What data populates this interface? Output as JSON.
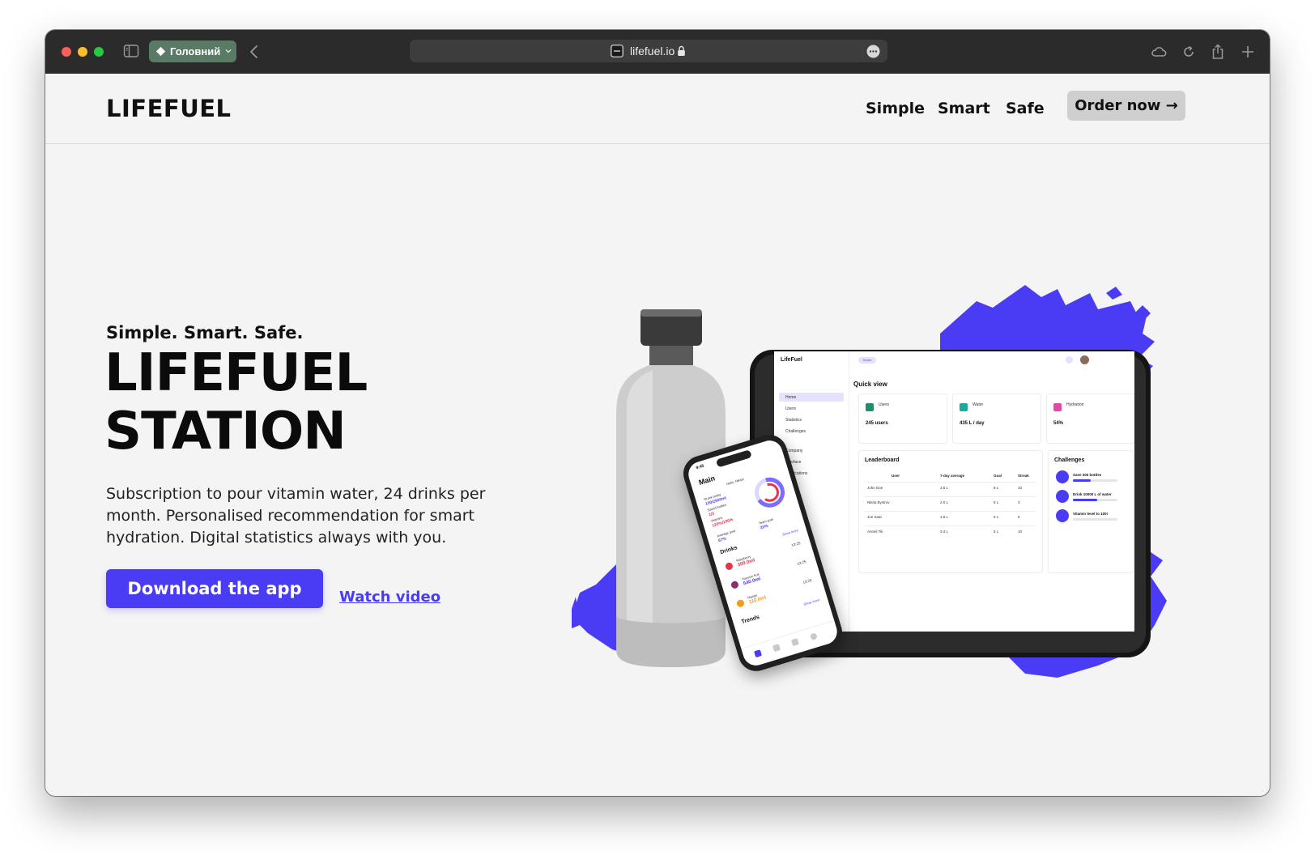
{
  "browser": {
    "tab_group_label": "Головний",
    "url": "lifefuel.io"
  },
  "site": {
    "logo": "LIFEFUEL",
    "nav": [
      "Simple",
      "Smart",
      "Safe"
    ],
    "order_button": "Order now →"
  },
  "hero": {
    "tagline": "Simple. Smart. Safe.",
    "title_line1": "LIFEFUEL",
    "title_line2": "STATION",
    "description": "Subscription to pour vitamin water, 24 drinks per month. Personalised recommendation for smart hydration. Digital statistics always with you.",
    "download_button": "Download the app",
    "watch_link": "Watch video"
  },
  "tablet": {
    "brand": "LifeFuel",
    "breadcrumb": "Home",
    "nav_items": [
      "Home",
      "Users",
      "Statistics",
      "Challenges",
      "Company",
      "Interface",
      "Notifications"
    ],
    "quick_view_title": "Quick view",
    "cards": [
      {
        "label": "Users",
        "value": "245 users",
        "color": "#1f8f6a"
      },
      {
        "label": "Water",
        "value": "435 L / day",
        "color": "#18a9a0"
      },
      {
        "label": "Hydration",
        "value": "54%",
        "color": "#e04aa8"
      }
    ],
    "leaderboard": {
      "title": "Leaderboard",
      "headers": [
        "User",
        "7-day average",
        "Goal",
        "Streak"
      ],
      "rows": [
        [
          "John Doe",
          "3.5 L",
          "5 L",
          "10"
        ],
        [
          "Nikita Bystrov",
          "2.0 L",
          "5 L",
          "3"
        ],
        [
          "Juri Saar",
          "1.5 L",
          "5 L",
          "6"
        ],
        [
          "Anneli Tik",
          "3.4 L",
          "5 L",
          "10"
        ]
      ]
    },
    "challenges": {
      "title": "Challenges",
      "items": [
        {
          "label": "Save 200 bottles",
          "progress": 0.4
        },
        {
          "label": "Drink 10000 L of water",
          "progress": 0.55
        },
        {
          "label": "Vitamin level to 100!",
          "progress": 0.0
        }
      ]
    }
  },
  "phone": {
    "time": "9:45",
    "title": "Main",
    "greeting": "Hello, Nikita!",
    "stats": [
      {
        "label": "Drank today",
        "value": "100/2500ml"
      },
      {
        "label": "Saved bottles",
        "value": "1/3"
      },
      {
        "label": "Vitamins",
        "value": "120%/100%"
      }
    ],
    "goals": [
      {
        "label": "Average goal",
        "value": "67%"
      },
      {
        "label": "Team goal",
        "value": "33%"
      }
    ],
    "drinks_title": "Drinks",
    "show_more": "Show more",
    "drinks": [
      {
        "name": "Raspberry",
        "amount": "300.0ml",
        "time": "13:25",
        "color": "#e8324a"
      },
      {
        "name": "Passion fruit",
        "amount": "540.0ml",
        "time": "13:25",
        "color": "#8b2c6e"
      },
      {
        "name": "Mango",
        "amount": "110.0ml",
        "time": "13:25",
        "color": "#f29a1a"
      }
    ],
    "trends_title": "Trends"
  },
  "colors": {
    "accent": "#4a3bf5",
    "page_background": "#f4f4f4",
    "chrome_background": "#2b2b2b",
    "tab_group": "#5a7a66"
  }
}
